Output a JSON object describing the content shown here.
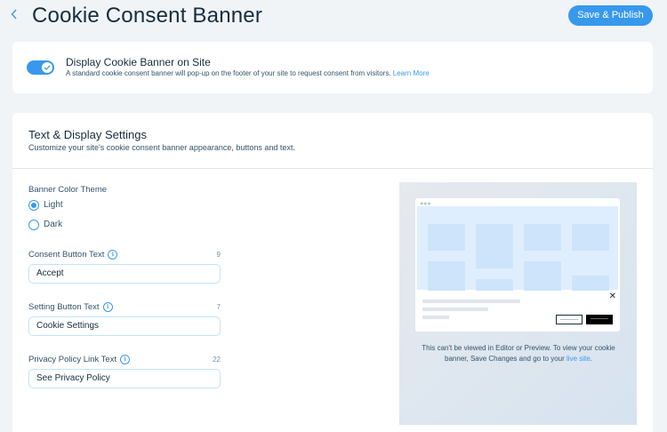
{
  "header": {
    "back_icon": "chevron-left-icon",
    "title": "Cookie Consent Banner",
    "publish_label": "Save & Publish"
  },
  "banner_toggle": {
    "enabled": true,
    "title": "Display Cookie Banner on Site",
    "description": "A standard cookie consent banner will pop-up on the footer of your site to request consent from visitors.",
    "learn_more": "Learn More"
  },
  "settings": {
    "title": "Text & Display Settings",
    "subtitle": "Customize your site's cookie consent banner appearance, buttons and text.",
    "theme": {
      "label": "Banner Color Theme",
      "options": [
        "Light",
        "Dark"
      ],
      "selected": "Light"
    },
    "consent": {
      "label": "Consent Button Text",
      "count": "9",
      "value": "Accept"
    },
    "setting": {
      "label": "Setting Button Text",
      "count": "7",
      "value": "Cookie Settings"
    },
    "privacy": {
      "label": "Privacy Policy Link Text",
      "count": "22",
      "value": "See Privacy Policy"
    }
  },
  "preview": {
    "note": "This can't be viewed in Editor or Preview. To view your cookie banner, Save Changes and go to your",
    "link": "live site",
    "after": "."
  },
  "colors": {
    "accent": "#3899ec",
    "title": "#162d3d",
    "background": "#f0f4f7"
  }
}
